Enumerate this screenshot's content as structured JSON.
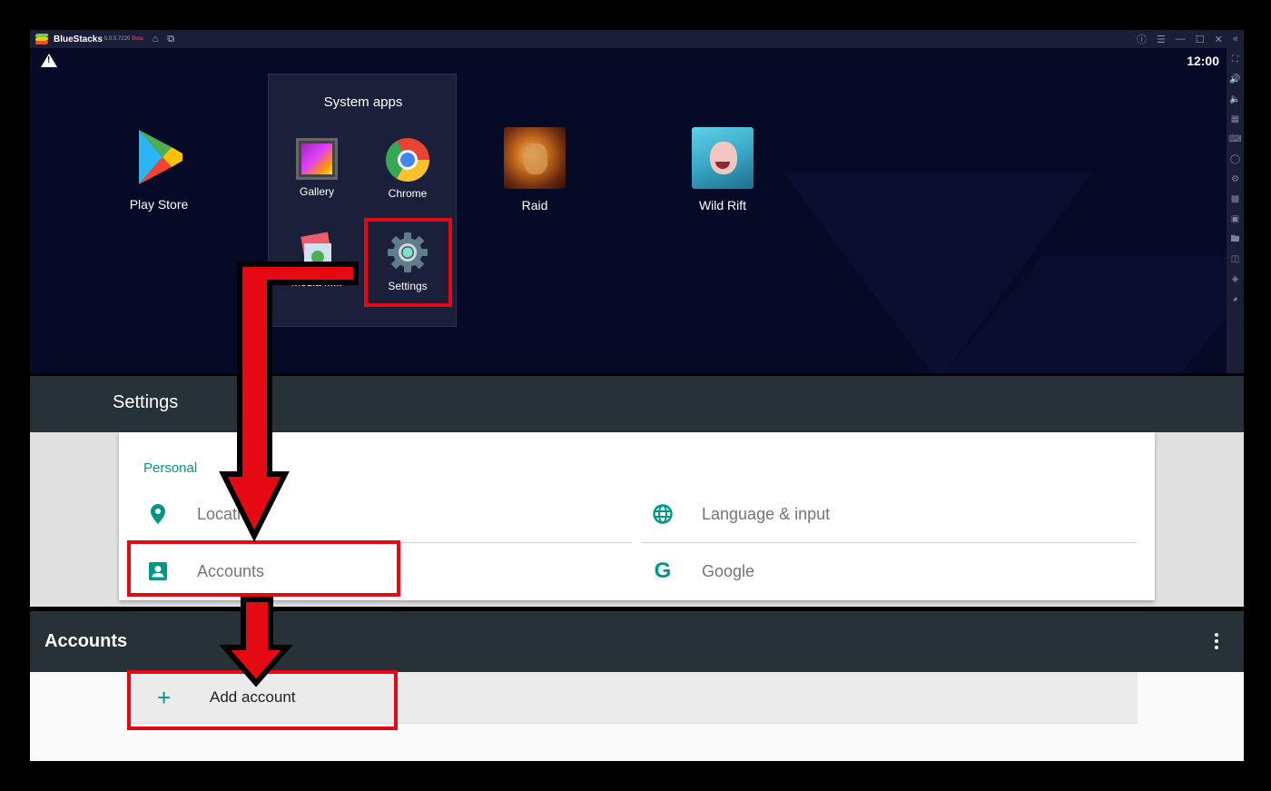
{
  "titlebar": {
    "app_name": "BlueStacks",
    "version": "5.0.0.7220",
    "channel": "Beta",
    "icons": [
      "home-icon",
      "multi-instance-icon"
    ],
    "controls": [
      "help-icon",
      "menu-icon",
      "minimize-icon",
      "maximize-icon",
      "close-icon",
      "collapse-sidebar-icon"
    ]
  },
  "status": {
    "clock": "12:00",
    "warning_icon": "warning-icon"
  },
  "home": {
    "apps": [
      {
        "label": "Play Store",
        "icon": "play-store-icon"
      },
      {
        "label": "Raid",
        "icon": "raid-icon"
      },
      {
        "label": "Wild Rift",
        "icon": "wild-rift-icon"
      }
    ],
    "system_folder": {
      "title": "System apps",
      "apps": [
        {
          "label": "Gallery",
          "icon": "gallery-icon"
        },
        {
          "label": "Chrome",
          "icon": "chrome-icon"
        },
        {
          "label": "Media M...",
          "icon": "media-manager-icon"
        },
        {
          "label": "Settings",
          "icon": "settings-gear-icon"
        }
      ]
    }
  },
  "side_toolbar": {
    "icons": [
      "fullscreen-icon",
      "volume-up-icon",
      "volume-down-icon",
      "keymap-icon",
      "keyboard-icon",
      "macro-icon",
      "gamepad-icon",
      "apk-install-icon",
      "screenshot-icon",
      "folder-icon",
      "rotate-icon",
      "layers-icon",
      "performance-icon"
    ]
  },
  "settings": {
    "title": "Settings",
    "section": "Personal",
    "items": [
      {
        "label": "Location",
        "visible_label": "Locati",
        "icon": "location-pin-icon"
      },
      {
        "label": "Language & input",
        "icon": "globe-icon"
      },
      {
        "label": "Accounts",
        "icon": "account-box-icon"
      },
      {
        "label": "Google",
        "icon": "google-g-icon"
      }
    ]
  },
  "accounts": {
    "title": "Accounts",
    "add_label": "Add account",
    "more_icon": "more-vert-icon"
  },
  "annotation": {
    "highlight_color": "#e50914",
    "outline_color": "#000000"
  }
}
